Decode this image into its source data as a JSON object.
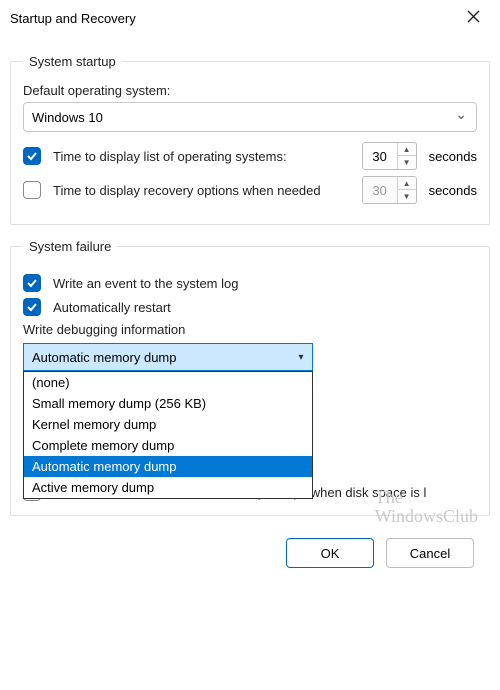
{
  "window": {
    "title": "Startup and Recovery"
  },
  "system_startup": {
    "legend": "System startup",
    "default_os_label": "Default operating system:",
    "default_os_value": "Windows 10",
    "display_list_label": "Time to display list of operating systems:",
    "display_list_checked": true,
    "display_list_seconds": "30",
    "recovery_label": "Time to display recovery options when needed",
    "recovery_checked": false,
    "recovery_seconds": "30",
    "seconds_suffix": "seconds"
  },
  "system_failure": {
    "legend": "System failure",
    "write_event_label": "Write an event to the system log",
    "write_event_checked": true,
    "auto_restart_label": "Automatically restart",
    "auto_restart_checked": true,
    "debug_label": "Write debugging information",
    "debug_selected": "Automatic memory dump",
    "debug_options": [
      "(none)",
      "Small memory dump (256 KB)",
      "Kernel memory dump",
      "Complete memory dump",
      "Automatic memory dump",
      "Active memory dump"
    ],
    "disable_auto_delete_label": "Disable automatic deletion of memory dumps when disk space is l",
    "disable_auto_delete_checked": false
  },
  "buttons": {
    "ok": "OK",
    "cancel": "Cancel"
  },
  "watermark": {
    "line1": "The",
    "line2": "WindowsClub"
  }
}
